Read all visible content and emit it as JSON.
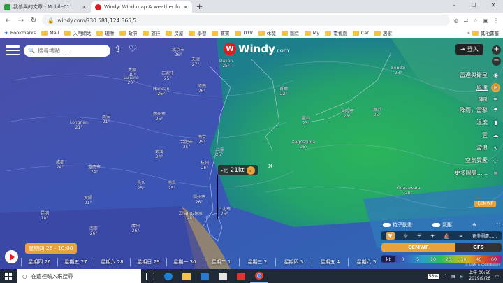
{
  "browser": {
    "tabs": [
      {
        "title": "我參與的文章 - Mobile01",
        "icon_color": "#2f9a3e"
      },
      {
        "title": "Windy: Wind map & weather fo",
        "icon_color": "#d71f26"
      }
    ],
    "new_tab": "+",
    "window_controls": [
      "–",
      "☐",
      "✕"
    ],
    "url": "windy.com/?30.581,124.365,5",
    "bookmarks": [
      "Bookmarks",
      "Mail",
      "入門網站",
      "理財",
      "政府",
      "旅行",
      "房屋",
      "學習",
      "寶寶",
      "DTV",
      "休閒",
      "醫院",
      "My",
      "電視劇",
      "Car",
      "居家"
    ],
    "bookmarks_more": "»",
    "other_bookmarks": "其他書籤"
  },
  "windy": {
    "search_placeholder": "搜尋地點......",
    "logo_text": "Windy",
    "logo_suffix": ".com",
    "login_label": "登入",
    "zoom_in": "+",
    "zoom_out": "−",
    "layers": [
      {
        "label": "雷達與衛星",
        "icon": "radar-icon",
        "glyph": "◉",
        "active": false
      },
      {
        "label": "風速",
        "icon": "wind-icon",
        "glyph": "≋",
        "active": true
      },
      {
        "label": "陣風",
        "icon": "gust-icon",
        "glyph": "≈",
        "active": false
      },
      {
        "label": "降雨，雷擊",
        "icon": "rain-icon",
        "glyph": "☂",
        "active": false
      },
      {
        "label": "溫度",
        "icon": "thermometer-icon",
        "glyph": "🌡",
        "active": false
      },
      {
        "label": "雲",
        "icon": "cloud-icon",
        "glyph": "☁",
        "active": false
      },
      {
        "label": "波浪",
        "icon": "wave-icon",
        "glyph": "∿",
        "active": false
      },
      {
        "label": "空氣質素",
        "icon": "air-quality-icon",
        "glyph": "◌",
        "active": false
      },
      {
        "label": "更多圖層......",
        "icon": "more-layers-icon",
        "glyph": "≡",
        "active": false
      }
    ],
    "popup": {
      "direction": "▸北",
      "value": "21kt"
    },
    "ecmwf_badge": "ECMWF",
    "toggles": [
      {
        "label": "粒子動畫"
      },
      {
        "label": "氣壓"
      }
    ],
    "forecast_more": "更多圖層......",
    "models": [
      "ECMWF",
      "GFS"
    ],
    "legend": {
      "unit": "kt",
      "values": [
        "0",
        "5",
        "10",
        "20",
        "30",
        "40",
        "60"
      ]
    },
    "time_badge": "星期四 26 - 10:00",
    "timeline": [
      "星期四 26",
      "星期五 27",
      "星期六 28",
      "星期日 29",
      "星期一 30",
      "星期二 1",
      "星期三 2",
      "星期四 3",
      "星期五 4",
      "星期六 5"
    ],
    "copyright": "© OSM & contributors",
    "cities": [
      {
        "name": "北京市",
        "temp": "26°"
      },
      {
        "name": "天津",
        "temp": "27°"
      },
      {
        "name": "太原",
        "temp": "20°"
      },
      {
        "name": "石家庄",
        "temp": "25°"
      },
      {
        "name": "濟南",
        "temp": "26°"
      },
      {
        "name": "Handan",
        "temp": "26°"
      },
      {
        "name": "Luliang",
        "temp": "20°"
      },
      {
        "name": "鄭州市",
        "temp": "26°"
      },
      {
        "name": "西安",
        "temp": "21°"
      },
      {
        "name": "Longnan",
        "temp": "21°"
      },
      {
        "name": "南京",
        "temp": "25°"
      },
      {
        "name": "合肥市",
        "temp": "25°"
      },
      {
        "name": "武漢",
        "temp": "24°"
      },
      {
        "name": "上海",
        "temp": "26°"
      },
      {
        "name": "杭州",
        "temp": "26°"
      },
      {
        "name": "成都",
        "temp": "24°"
      },
      {
        "name": "重慶市",
        "temp": "24°"
      },
      {
        "name": "長沙",
        "temp": "25°"
      },
      {
        "name": "南昌",
        "temp": "25°"
      },
      {
        "name": "福州市",
        "temp": "26°"
      },
      {
        "name": "Zhangzhou",
        "temp": "28°"
      },
      {
        "name": "台北市",
        "temp": "26°"
      },
      {
        "name": "貴陽",
        "temp": "21°"
      },
      {
        "name": "昆明",
        "temp": "18°"
      },
      {
        "name": "南寧",
        "temp": "26°"
      },
      {
        "name": "廣州",
        "temp": "26°"
      },
      {
        "name": "Dalian",
        "temp": "25°"
      },
      {
        "name": "首爾",
        "temp": "22°"
      },
      {
        "name": "釜山",
        "temp": "23°"
      },
      {
        "name": "東京",
        "temp": "25°"
      },
      {
        "name": "大阪市",
        "temp": "26°"
      },
      {
        "name": "Kagoshima",
        "temp": "26°"
      },
      {
        "name": "Sendai",
        "temp": "23°"
      },
      {
        "name": "Ogasawara",
        "temp": "28°"
      }
    ]
  },
  "taskbar": {
    "search_placeholder": "在這裡輸入來搜尋",
    "battery": "58%",
    "time": "上午 09:50",
    "date": "2019/9/26"
  },
  "colors": {
    "accent": "#e8a23b",
    "brand": "#d71f26"
  }
}
